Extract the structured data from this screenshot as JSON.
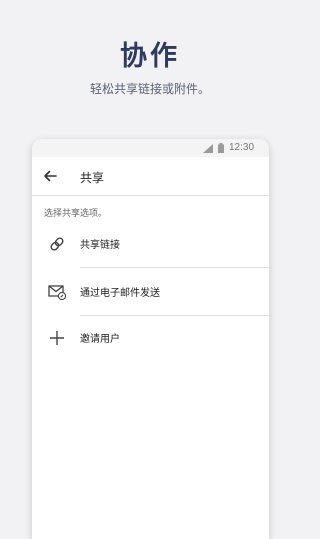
{
  "promo": {
    "title": "协作",
    "subtitle": "轻松共享链接或附件。"
  },
  "status_bar": {
    "time": "12:30",
    "icons": [
      "signal-icon",
      "battery-icon"
    ]
  },
  "app_bar": {
    "back_icon": "arrow-left-icon",
    "title": "共享"
  },
  "hint": "选择共享选项。",
  "options": [
    {
      "icon": "link-icon",
      "label": "共享链接"
    },
    {
      "icon": "mail-attachment-icon",
      "label": "通过电子邮件发送"
    },
    {
      "icon": "plus-icon",
      "label": "邀请用户"
    }
  ]
}
